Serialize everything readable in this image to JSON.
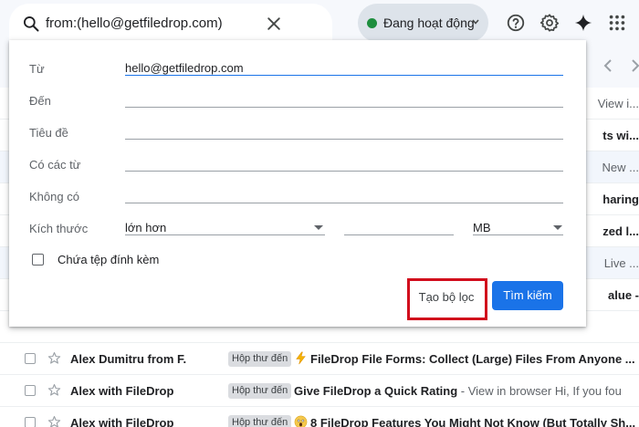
{
  "search": {
    "query": "from:(hello@getfiledrop.com)"
  },
  "status": {
    "label": "Đang hoạt động",
    "color": "#1e8e3e"
  },
  "top_icons": [
    "help-icon",
    "settings-icon",
    "gemini-icon",
    "apps-grid-icon"
  ],
  "advanced_search": {
    "fields": [
      {
        "label": "Từ",
        "value": "hello@getfiledrop.com"
      },
      {
        "label": "Đến",
        "value": ""
      },
      {
        "label": "Tiêu đề",
        "value": ""
      },
      {
        "label": "Có các từ",
        "value": ""
      },
      {
        "label": "Không có",
        "value": ""
      }
    ],
    "size": {
      "label": "Kích thước",
      "comparator": "lớn hơn",
      "amount": "",
      "unit": "MB"
    },
    "attachment_label": "Chứa tệp đính kèm",
    "create_filter_label": "Tạo bộ lọc",
    "search_button_label": "Tìm kiếm",
    "accent_color": "#1a73e8",
    "highlight_color": "#d10b1c"
  },
  "background_snippets": [
    {
      "text": "View i...",
      "bold": false
    },
    {
      "text": "ts wi...",
      "bold": true
    },
    {
      "text": "New ...",
      "bold": false
    },
    {
      "text": "haring",
      "bold": true
    },
    {
      "text": "zed l...",
      "bold": true
    },
    {
      "text": "Live ...",
      "bold": false
    },
    {
      "text": "alue -",
      "bold": true
    }
  ],
  "emails": [
    {
      "sender": "Alex Dumitru from F.",
      "label": "Hộp thư đến",
      "emoji": "lightning-emoji",
      "subject": "FileDrop File Forms: Collect (Large) Files From Anyone ...",
      "snippet": ""
    },
    {
      "sender": "Alex with FileDrop",
      "label": "Hộp thư đến",
      "emoji": "",
      "subject": "Give FileDrop a Quick Rating",
      "snippet": " - View in browser Hi, If you fou"
    },
    {
      "sender": "Alex with FileDrop",
      "label": "Hộp thư đến",
      "emoji": "scream-emoji",
      "subject": "8 FileDrop Features You Might Not Know (But Totally Sh...",
      "snippet": ""
    }
  ]
}
